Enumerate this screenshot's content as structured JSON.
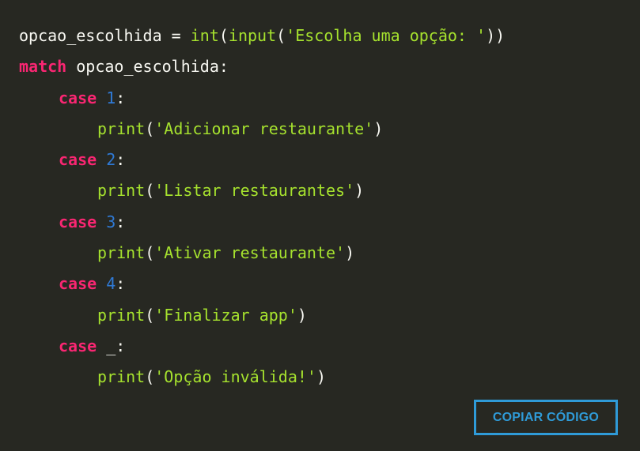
{
  "code": {
    "line1": {
      "var": "opcao_escolhida",
      "assign": " = ",
      "fn_int": "int",
      "paren_open": "(",
      "fn_input": "input",
      "paren_open2": "(",
      "str": "'Escolha uma opção: '",
      "paren_close": "))"
    },
    "line2": {
      "kw": "match",
      "rest": " opcao_escolhida:"
    },
    "cases": [
      {
        "kw": "case",
        "value": "1",
        "colon": ":",
        "fn": "print",
        "open": "(",
        "arg": "'Adicionar restaurante'",
        "close": ")"
      },
      {
        "kw": "case",
        "value": "2",
        "colon": ":",
        "fn": "print",
        "open": "(",
        "arg": "'Listar restaurantes'",
        "close": ")"
      },
      {
        "kw": "case",
        "value": "3",
        "colon": ":",
        "fn": "print",
        "open": "(",
        "arg": "'Ativar restaurante'",
        "close": ")"
      },
      {
        "kw": "case",
        "value": "4",
        "colon": ":",
        "fn": "print",
        "open": "(",
        "arg": "'Finalizar app'",
        "close": ")"
      },
      {
        "kw": "case",
        "value": "_",
        "colon": ":",
        "fn": "print",
        "open": "(",
        "arg": "'Opção inválida!'",
        "close": ")"
      }
    ]
  },
  "copy_button": {
    "label": "COPIAR CÓDIGO"
  },
  "colors": {
    "background": "#272822",
    "keyword": "#f92672",
    "function": "#a6e22e",
    "string": "#a6e22e",
    "number": "#2f7ad6",
    "plain": "#f8f8f2",
    "button": "#2f9bd8"
  }
}
